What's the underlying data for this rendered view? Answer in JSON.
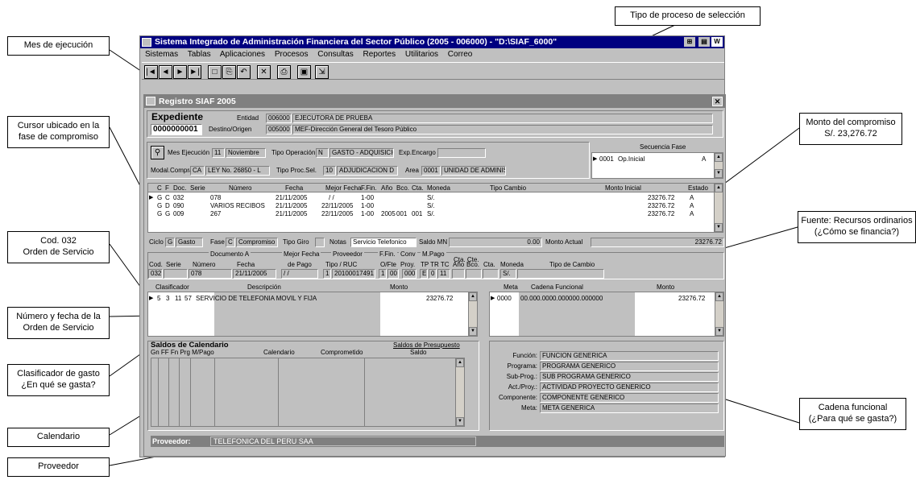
{
  "callouts": {
    "mes": "Mes de ejecución",
    "tipo_proceso": "Tipo de proceso de selección",
    "cursor_l1": "Cursor ubicado en la",
    "cursor_l2": "fase de compromiso",
    "monto_l1": "Monto del compromiso",
    "monto_l2": "S/. 23,276.72",
    "cod_l1": "Cod. 032",
    "cod_l2": "Orden de Servicio",
    "fuente_l1": "Fuente: Recursos ordinarios",
    "fuente_l2": "(¿Cómo se financia?)",
    "numero_l1": "Número y fecha de la",
    "numero_l2": "Orden de Servicio",
    "clasif_l1": "Clasificador de gasto",
    "clasif_l2": "¿En qué se gasta?",
    "cadena_l1": "Cadena funcional",
    "cadena_l2": "(¿Para qué  se gasta?)",
    "calendario": "Calendario",
    "proveedor": "Proveedor"
  },
  "app": {
    "title": "Sistema Integrado de Administración Financiera del Sector Público (2005 - 006000) - \"D:\\SIAF_6000\"",
    "menu": [
      "Sistemas",
      "Tablas",
      "Aplicaciones",
      "Procesos",
      "Consultas",
      "Reportes",
      "Utilitarios",
      "Correo"
    ],
    "toolbar": [
      "|◄",
      "◄",
      "►",
      "►|",
      "□",
      "⎘",
      "↶",
      "✕",
      "⎙",
      "▣",
      "⇲"
    ]
  },
  "form": {
    "title": "Registro SIAF 2005",
    "expediente_label": "Expediente",
    "expediente_value": "0000000001",
    "entidad_label": "Entidad",
    "entidad_code": "006000",
    "entidad_name": "EJECUTORA DE PRUEBA",
    "destino_label": "Destino/Origen",
    "destino_code": "005000",
    "destino_name": "MEF-Dirección General del Tesoro Público",
    "mes_label": "Mes Ejecución",
    "mes_num": "11",
    "mes_name": "Noviembre",
    "tipo_op_label": "Tipo Operación",
    "tipo_op_code": "N",
    "tipo_op_name": "GASTO - ADQUISICION D",
    "exp_encargo_label": "Exp.Encargo",
    "modal_label": "Modal.Compra",
    "modal_code": "CA",
    "modal_name": "LEY No. 26850 - L",
    "tipo_proc_label": "Tipo Proc.Sel.",
    "tipo_proc_code": "10",
    "tipo_proc_name": "ADJUDICACION D",
    "area_label": "Area",
    "area_code": "0001",
    "area_name": "UNIDAD DE ADMINIS",
    "secuencia_label": "Secuencia Fase",
    "secuencia_code": "0001",
    "secuencia_name": "Op.Inicial",
    "secuencia_estado": "A"
  },
  "fases": {
    "headers": [
      "C",
      "F",
      "Doc.",
      "Serie",
      "Número",
      "Fecha",
      "Mejor Fecha",
      "F.Fin.",
      "Año",
      "Bco.",
      "Cta.",
      "Moneda",
      "Tipo Cambio",
      "Monto Inicial",
      "Estado"
    ],
    "rows": [
      [
        "G",
        "C",
        "032",
        "",
        "078",
        "21/11/2005",
        "  /  /",
        "1-00",
        "",
        "",
        "",
        "S/.",
        "",
        "23276.72",
        "A"
      ],
      [
        "G",
        "D",
        "090",
        "",
        "VARIOS RECIBOS",
        "21/11/2005",
        "22/11/2005",
        "1-00",
        "",
        "",
        "",
        "S/.",
        "",
        "23276.72",
        "A"
      ],
      [
        "G",
        "G",
        "009",
        "",
        "267",
        "21/11/2005",
        "22/11/2005",
        "1-00",
        "2005",
        "001",
        "001",
        "S/.",
        "",
        "23276.72",
        "A"
      ]
    ]
  },
  "ciclo": {
    "ciclo_label": "Ciclo",
    "ciclo_code": "G",
    "ciclo_name": "Gasto",
    "fase_label": "Fase",
    "fase_code": "C",
    "fase_name": "Compromiso",
    "tipo_giro_label": "Tipo Giro",
    "notas_label": "Notas",
    "notas_value": "Servicio Telefonico",
    "saldo_label": "Saldo MN",
    "saldo_value": "0.00",
    "monto_actual_label": "Monto Actual",
    "monto_actual_value": "23276.72"
  },
  "doc": {
    "documento_a": "Documento A",
    "mejor_fecha": "Mejor Fecha",
    "proveedor": "Proveedor",
    "ffin": "F.Fin.",
    "conv": "Conv",
    "mpago": "M.Pago",
    "ctacte": "Cta. Cte.",
    "cod": "Cod.",
    "serie": "Serie",
    "numero": "Número",
    "fecha": "Fecha",
    "de_pago": "de Pago",
    "tipo_ruc": "Tipo / RUC",
    "ofte": "O/Fte",
    "proy": "Proy.",
    "tp_tr_tc": "TP TR TC",
    "anio": "Año",
    "bco": "Bco.",
    "cta": "Cta.",
    "moneda": "Moneda",
    "tipo_cambio": "Tipo de Cambio",
    "cod_v": "032",
    "serie_v": "",
    "numero_v": "078",
    "fecha_v": "21/11/2005",
    "depago_v": "  /  /",
    "tipo_v": "1",
    "ruc_v": "20100017491",
    "o_v": "1",
    "fte_v": "00",
    "proy_v": "000",
    "tp_v": "E",
    "tr_v": "0",
    "tc_v": "11",
    "moneda_v": "S/."
  },
  "clasif": {
    "headers": {
      "c": "Clasificador",
      "d": "Descripción",
      "m": "Monto"
    },
    "row": {
      "a": "5",
      "b": "3",
      "c": "11",
      "d": "57",
      "desc": "SERVICIO DE TELEFONIA MOVIL Y FIJA",
      "monto": "23276.72"
    }
  },
  "meta": {
    "headers": {
      "meta": "Meta",
      "cadena": "Cadena Funcional",
      "monto": "Monto"
    },
    "row": {
      "meta": "0000",
      "cadena": "00.000.0000.000000.000000",
      "monto": "23276.72"
    }
  },
  "saldos": {
    "title": "Saldos de Calendario",
    "link": "Saldos de Presupuesto",
    "headers": [
      "Gn FF Fn Prg M/Pago",
      "Calendario",
      "Comprometido",
      "Saldo"
    ]
  },
  "funcional": {
    "funcion_label": "Función:",
    "funcion": "FUNCION GENERICA",
    "programa_label": "Programa:",
    "programa": "PROGRAMA GENERICO",
    "subprog_label": "Sub-Prog.:",
    "subprog": "SUB PROGRAMA GENERICO",
    "actproy_label": "Act./Proy.:",
    "actproy": "ACTIVIDAD PROYECTO GENERICO",
    "componente_label": "Componente:",
    "componente": "COMPONENTE GENERICO",
    "meta_label": "Meta:",
    "meta": "META GENERICA"
  },
  "status": {
    "proveedor_label": "Proveedor:",
    "proveedor_value": "TELEFONICA DEL PERU SAA"
  }
}
